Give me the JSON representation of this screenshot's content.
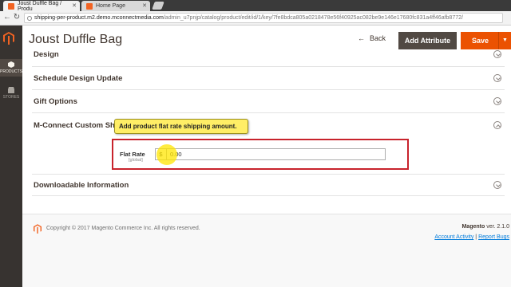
{
  "browser": {
    "tabs": [
      {
        "title": "Joust Duffle Bag / Produ",
        "active": true
      },
      {
        "title": "Home Page",
        "active": false
      }
    ],
    "url_host": "shipping-per-product.m2.demo.mconnectmedia.com",
    "url_path": "/admin_u7pnjp/catalog/product/edit/id/1/key/7fe8bdca805a0218478e56f40925ac082be9e146e17680fc831a4ff46afb8772/"
  },
  "sidebar": {
    "items": [
      {
        "label": "PRODUCTS",
        "icon": "cube-icon",
        "active": true
      },
      {
        "label": "STORES",
        "icon": "store-icon",
        "active": false
      }
    ]
  },
  "header": {
    "title": "Joust Duffle Bag",
    "back_label": "Back",
    "add_attribute_label": "Add Attribute",
    "save_label": "Save"
  },
  "sections": {
    "design": "Design",
    "schedule": "Schedule Design Update",
    "gift": "Gift Options",
    "mconnect": "M-Connect Custom Ship",
    "downloadable": "Downloadable Information"
  },
  "tooltip": "Add product flat rate shipping amount.",
  "flat_rate": {
    "label": "Flat Rate",
    "scope": "[global]",
    "currency": "$",
    "value": "0.00"
  },
  "footer": {
    "copyright": "Copyright © 2017 Magento Commerce Inc. All rights reserved.",
    "brand": "Magento",
    "version": "ver. 2.1.0",
    "account_activity": "Account Activity",
    "separator": "|",
    "report_bugs": "Report Bugs"
  },
  "colors": {
    "save": "#eb5202",
    "attribute_button": "#514943",
    "highlight": "#c8232c",
    "tooltip": "#ffee66"
  }
}
